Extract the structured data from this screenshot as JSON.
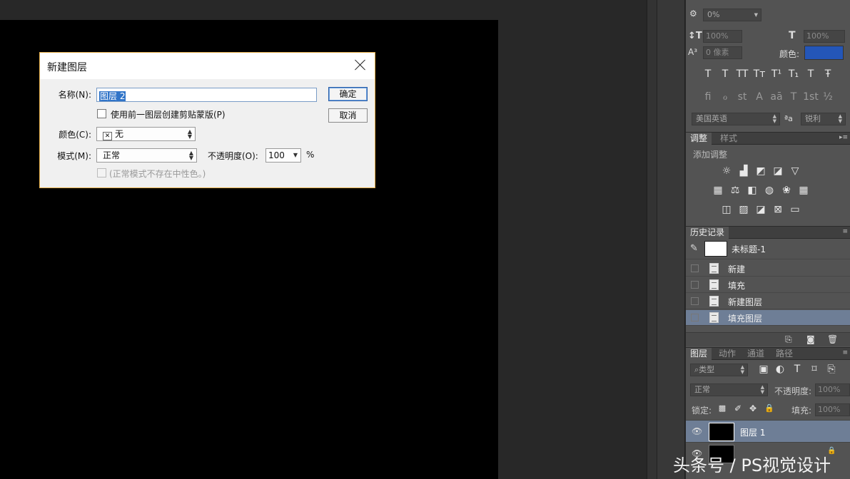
{
  "dialog": {
    "title": "新建图层",
    "name_label": "名称(N):",
    "name_value": "图层 2",
    "use_prev_label": "使用前一图层创建剪贴蒙版(P)",
    "color_label": "颜色(C):",
    "color_value": "无",
    "mode_label": "模式(M):",
    "mode_value": "正常",
    "opacity_label": "不透明度(O):",
    "opacity_value": "100",
    "opacity_unit": "%",
    "neutral_label": "(正常模式不存在中性色。)",
    "ok": "确定",
    "cancel": "取消"
  },
  "character": {
    "tracking": "0%",
    "vscale": "100%",
    "hscale": "100%",
    "baseline": "0 像素",
    "color_label": "颜色:",
    "color_swatch": "#2456b8",
    "style_glyphs": [
      "T",
      "T",
      "TT",
      "Tт",
      "T¹",
      "T₁",
      "T",
      "Ŧ"
    ],
    "ot_glyphs": [
      "fi",
      "ℴ",
      "st",
      "A",
      "aā",
      "T",
      "1st",
      "½"
    ],
    "language": "美国英语",
    "aa_icon": "ªa",
    "antialias": "锐利"
  },
  "adjustments": {
    "tabs": [
      "调整",
      "样式"
    ],
    "add_label": "添加调整"
  },
  "history": {
    "tab": "历史记录",
    "snapshot": "未标题-1",
    "items": [
      "新建",
      "填充",
      "新建图层",
      "填充图层"
    ]
  },
  "layers": {
    "tabs": [
      "图层",
      "动作",
      "通道",
      "路径"
    ],
    "filter": "类型",
    "blend": "正常",
    "opacity_label": "不透明度:",
    "opacity": "100%",
    "lock_label": "锁定:",
    "fill_label": "填充:",
    "fill": "100%",
    "layer1": "图层 1"
  },
  "watermark": "头条号 / PS视觉设计"
}
